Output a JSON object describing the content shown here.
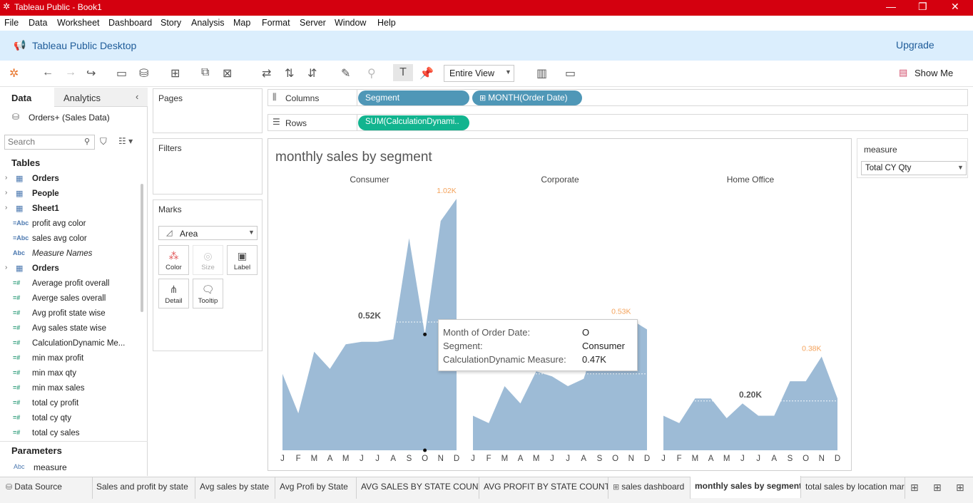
{
  "window": {
    "title": "Tableau Public - Book1"
  },
  "menu": [
    "File",
    "Data",
    "Worksheet",
    "Dashboard",
    "Story",
    "Analysis",
    "Map",
    "Format",
    "Server",
    "Window",
    "Help"
  ],
  "banner": {
    "app_name": "Tableau Public Desktop",
    "upgrade": "Upgrade"
  },
  "toolbar": {
    "fit": "Entire View",
    "show_me": "Show Me"
  },
  "left": {
    "tab_data": "Data",
    "tab_analytics": "Analytics",
    "datasource": "Orders+ (Sales Data)",
    "search_placeholder": "Search",
    "tables_header": "Tables",
    "fields": [
      {
        "label": "Orders",
        "kind": "table"
      },
      {
        "label": "People",
        "kind": "table"
      },
      {
        "label": "Sheet1",
        "kind": "table"
      },
      {
        "label": "profit avg color",
        "kind": "calc-dim"
      },
      {
        "label": "sales avg color",
        "kind": "calc-dim"
      },
      {
        "label": "Measure Names",
        "kind": "dim-italic"
      },
      {
        "label": "Orders",
        "kind": "table"
      },
      {
        "label": "Average profit overall",
        "kind": "calc-measure"
      },
      {
        "label": "Averge sales overall",
        "kind": "calc-measure"
      },
      {
        "label": "Avg profit state wise",
        "kind": "calc-measure"
      },
      {
        "label": "Avg sales state wise",
        "kind": "calc-measure"
      },
      {
        "label": "CalculationDynamic Me...",
        "kind": "calc-measure"
      },
      {
        "label": "min max  profit",
        "kind": "calc-measure"
      },
      {
        "label": "min max  qty",
        "kind": "calc-measure"
      },
      {
        "label": "min max sales",
        "kind": "calc-measure"
      },
      {
        "label": "total cy profit",
        "kind": "calc-measure"
      },
      {
        "label": "total cy qty",
        "kind": "calc-measure"
      },
      {
        "label": "total cy sales",
        "kind": "calc-measure"
      }
    ],
    "parameters_header": "Parameters",
    "parameter": "measure"
  },
  "cards": {
    "pages": "Pages",
    "filters": "Filters",
    "marks": "Marks",
    "mark_type": "Area",
    "buttons": [
      "Color",
      "Size",
      "Label",
      "Detail",
      "Tooltip"
    ]
  },
  "shelves": {
    "columns_label": "Columns",
    "rows_label": "Rows",
    "columns_pills": [
      "Segment",
      "MONTH(Order Date)"
    ],
    "rows_pills": [
      "SUM(CalculationDynami.."
    ]
  },
  "parameter_card": {
    "title": "measure",
    "value": "Total CY Qty"
  },
  "colors": {
    "area": "#9dbbd6",
    "pill_dim": "#4f97b7",
    "pill_measure": "#12b48f",
    "max_label": "#f4a25a",
    "titlebar": "#d4000f"
  },
  "chart_data": {
    "type": "area",
    "title": "monthly sales by segment",
    "months": [
      "J",
      "F",
      "M",
      "A",
      "M",
      "J",
      "J",
      "A",
      "S",
      "O",
      "N",
      "D"
    ],
    "series": [
      {
        "name": "Consumer",
        "values": [
          0.31,
          0.15,
          0.4,
          0.33,
          0.43,
          0.44,
          0.44,
          0.45,
          0.86,
          0.47,
          0.93,
          1.02
        ],
        "avg_label": "0.52K",
        "max_label": "1.02K",
        "avg": 0.52
      },
      {
        "name": "Corporate",
        "values": [
          0.14,
          0.11,
          0.26,
          0.19,
          0.32,
          0.3,
          0.26,
          0.29,
          0.49,
          0.48,
          0.53,
          0.49
        ],
        "avg_label": "",
        "max_label": "0.53K",
        "avg": 0.31
      },
      {
        "name": "Home Office",
        "values": [
          0.14,
          0.11,
          0.21,
          0.21,
          0.13,
          0.19,
          0.14,
          0.14,
          0.28,
          0.28,
          0.38,
          0.21
        ],
        "avg_label": "0.20K",
        "max_label": "0.38K",
        "avg": 0.2
      }
    ],
    "ylim": [
      0,
      1.02
    ]
  },
  "tooltip": {
    "rows": [
      {
        "key": "Month of Order Date:",
        "value": "O"
      },
      {
        "key": "Segment:",
        "value": "Consumer"
      },
      {
        "key": "CalculationDynamic Measure:",
        "value": "0.47K"
      }
    ]
  },
  "tabs": [
    "Data Source",
    "Sales and profit by state",
    "Avg sales by state",
    "Avg Profi by State",
    "AVG SALES BY STATE COUNT",
    "AVG PROFIT BY STATE COUNT",
    "sales dashboard",
    "monthly sales by segment",
    "total sales by location mar"
  ],
  "active_tab": "monthly sales by segment"
}
